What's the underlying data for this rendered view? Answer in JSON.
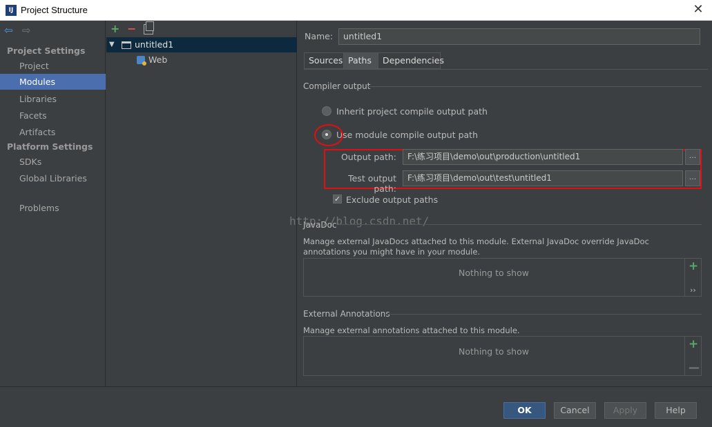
{
  "window": {
    "title": "Project Structure",
    "icon_text": "IJ",
    "close_glyph": "✕"
  },
  "nav": {
    "back_glyph": "⇦",
    "forward_glyph": "⇨",
    "project_settings_heading": "Project Settings",
    "project_items": [
      "Project",
      "Modules",
      "Libraries",
      "Facets",
      "Artifacts"
    ],
    "platform_settings_heading": "Platform Settings",
    "platform_items": [
      "SDKs",
      "Global Libraries"
    ],
    "problems": "Problems",
    "selected": "Modules"
  },
  "tree": {
    "add_glyph": "+",
    "remove_glyph": "−",
    "expand_glyph": "▼",
    "root": "untitled1",
    "child": "Web"
  },
  "module": {
    "name_label": "Name:",
    "name_value": "untitled1",
    "tabs": [
      "Sources",
      "Paths",
      "Dependencies"
    ],
    "active_tab": "Paths"
  },
  "compiler": {
    "section_title": "Compiler output",
    "inherit_label": "Inherit project compile output path",
    "use_module_label": "Use module compile output path",
    "selected_option": "use_module",
    "output_path_label": "Output path:",
    "output_path_value": "F:\\练习项目\\demo\\out\\production\\untitled1",
    "test_output_path_label": "Test output path:",
    "test_output_path_value": "F:\\练习项目\\demo\\out\\test\\untitled1",
    "browse_glyph": "...",
    "exclude_label": "Exclude output paths",
    "exclude_checked": true,
    "check_glyph": "✓"
  },
  "watermark": "http://blog.csdn.net/",
  "javadoc": {
    "section_title": "JavaDoc",
    "description": "Manage external JavaDocs attached to this module. External JavaDoc override JavaDoc annotations you might have in your module.",
    "empty_text": "Nothing to show",
    "add_glyph": "+",
    "more_glyph": "››"
  },
  "annotations": {
    "section_title": "External Annotations",
    "description": "Manage external annotations attached to this module.",
    "empty_text": "Nothing to show",
    "add_glyph": "+",
    "remove_glyph": "—"
  },
  "footer": {
    "ok": "OK",
    "cancel": "Cancel",
    "apply": "Apply",
    "help": "Help"
  },
  "colors": {
    "selection": "#4b6eaf",
    "annotation_red": "#e01010",
    "primary_button": "#365880"
  }
}
